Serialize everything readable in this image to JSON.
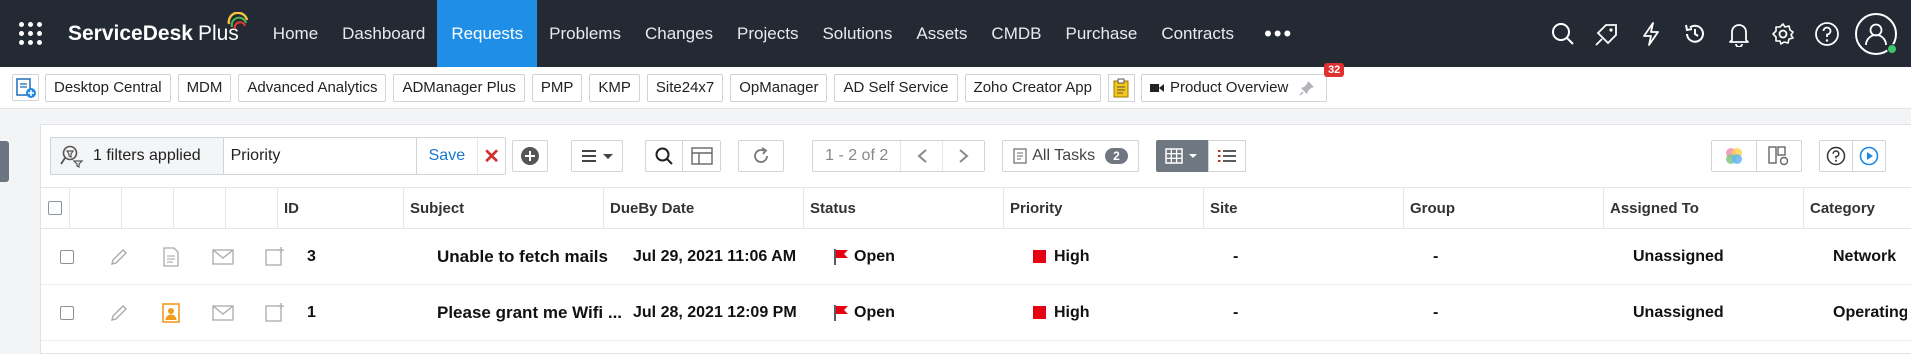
{
  "brand": {
    "name": "ServiceDesk",
    "suffix": "Plus"
  },
  "nav": {
    "items": [
      "Home",
      "Dashboard",
      "Requests",
      "Problems",
      "Changes",
      "Projects",
      "Solutions",
      "Assets",
      "CMDB",
      "Purchase",
      "Contracts"
    ],
    "active": "Requests",
    "more": "•••"
  },
  "quicklinks": {
    "items": [
      "Desktop Central",
      "MDM",
      "Advanced Analytics",
      "ADManager Plus",
      "PMP",
      "KMP",
      "Site24x7",
      "OpManager",
      "AD Self Service",
      "Zoho Creator App"
    ],
    "product_overview": "Product Overview",
    "badge": "32"
  },
  "toolbar": {
    "filters_text": "1 filters applied",
    "filter_value": "Priority",
    "save_label": "Save",
    "pager_text": "1 - 2 of 2",
    "all_tasks_label": "All Tasks",
    "all_tasks_count": "2"
  },
  "table": {
    "columns": [
      "ID",
      "Subject",
      "DueBy Date",
      "Status",
      "Priority",
      "Site",
      "Group",
      "Assigned To",
      "Category"
    ],
    "rows": [
      {
        "id": "3",
        "subject": "Unable to fetch mails",
        "due": "Jul 29, 2021 11:06 AM",
        "status": "Open",
        "priority": "High",
        "site": "-",
        "group": "-",
        "assigned": "Unassigned",
        "category": "Network"
      },
      {
        "id": "1",
        "subject": "Please grant me Wifi ...",
        "due": "Jul 28, 2021 12:09 PM",
        "status": "Open",
        "priority": "High",
        "site": "-",
        "group": "-",
        "assigned": "Unassigned",
        "category": "Operating"
      }
    ]
  },
  "colors": {
    "nav_bg": "#232a33",
    "accent": "#1f8ee6",
    "priority_high": "#e60012",
    "status_open_flag": "#e60012"
  }
}
